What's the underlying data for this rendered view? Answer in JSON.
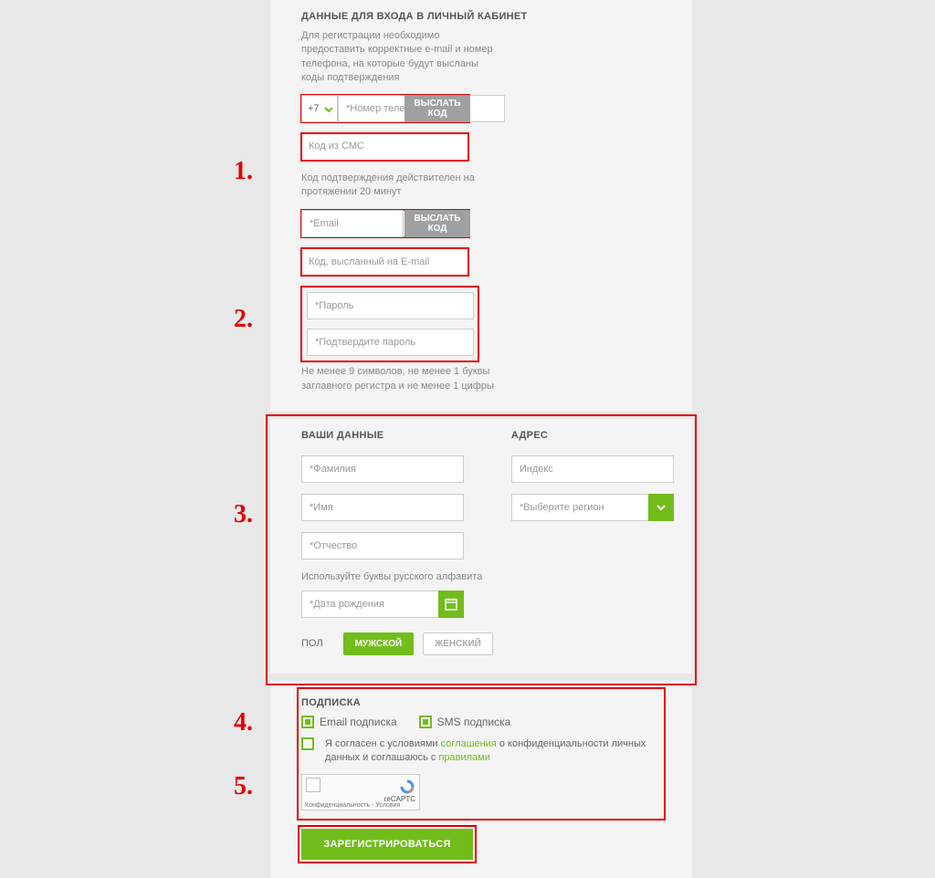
{
  "callouts": {
    "n1": "1.",
    "n2": "2.",
    "n3": "3.",
    "n4": "4.",
    "n5": "5."
  },
  "login": {
    "title": "ДАННЫЕ ДЛЯ ВХОДА В ЛИЧНЫЙ КАБИНЕТ",
    "desc": "Для регистрации необходимо предоставить корректные e-mail и номер телефона, на которые будут высланы коды подтверждения",
    "country_code": "+7",
    "phone_ph": "*Номер телефона",
    "send_code": "ВЫСЛАТЬ КОД",
    "sms_ph": "Код из СМС",
    "code_hint": "Код подтверждения действителен на протяжении 20 минут",
    "email_ph": "*Email",
    "email_code_ph": "Код, высланный на E-mail",
    "pw_ph": "*Пароль",
    "pw2_ph": "*Подтвердите пароль",
    "pw_hint": "Не менее 9 символов, не менее 1 буквы заглавного регистра и не менее 1 цифры"
  },
  "personal": {
    "title_left": "ВАШИ ДАННЫЕ",
    "title_right": "АДРЕС",
    "lastname_ph": "*Фамилия",
    "firstname_ph": "*Имя",
    "middlename_ph": "*Отчество",
    "alpha_hint": "Используйте буквы русского алфавита",
    "dob_ph": "*Дата рождения",
    "gender_label": "ПОЛ",
    "gender_m": "МУЖСКОЙ",
    "gender_f": "ЖЕНСКИЙ",
    "index_ph": "Индекс",
    "region_ph": "*Выберите регион"
  },
  "subs": {
    "title": "ПОДПИСКА",
    "email_sub": "Email подписка",
    "sms_sub": "SMS подписка",
    "agree_pre": "Я согласен с условиями ",
    "agree_link1": "соглашения",
    "agree_mid": " о конфиденциальности личных данных и соглашаюсь с ",
    "agree_link2": "правилами",
    "captcha_brand": "reCAPTC",
    "captcha_foot": "Конфиденциальность - Условия"
  },
  "submit": {
    "label": "ЗАРЕГИСТРИРОВАТЬСЯ"
  }
}
